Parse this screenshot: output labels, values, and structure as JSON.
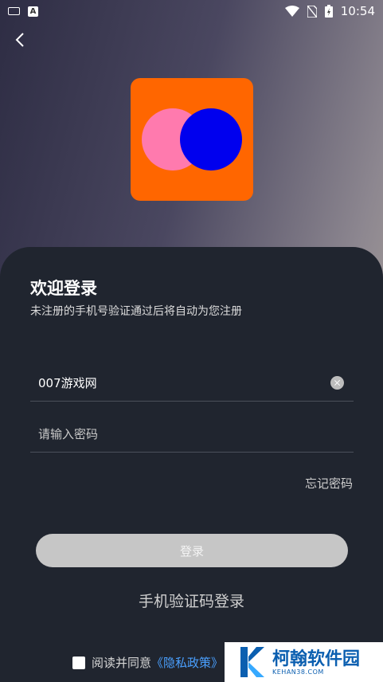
{
  "status_bar": {
    "keyboard_icon": "keyboard-icon",
    "a_badge": "A",
    "time": "10:54"
  },
  "nav": {
    "back_icon": "chevron-left-icon"
  },
  "logo": {
    "bg_color": "#ff6600",
    "circle_left_color": "#ff7aae",
    "circle_right_color": "#0000ee"
  },
  "login": {
    "title": "欢迎登录",
    "subtitle": "未注册的手机号验证通过后将自动为您注册",
    "phone_value": "007游戏网",
    "password_placeholder": "请输入密码",
    "forgot_password": "忘记密码",
    "login_button": "登录",
    "sms_login": "手机验证码登录",
    "agreement_text": "阅读并同意",
    "privacy_policy": "《隐私政策》"
  },
  "watermark": {
    "name": "柯翰软件园",
    "url": "KEHAN38.COM"
  }
}
